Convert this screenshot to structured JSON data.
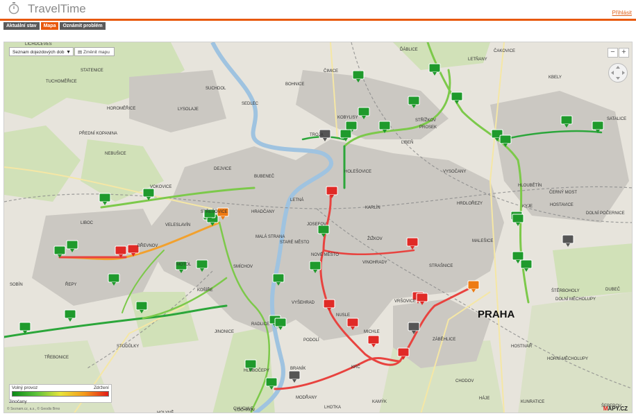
{
  "header": {
    "title": "TravelTime",
    "login": "Přihlásit"
  },
  "tabs": [
    {
      "label": "Aktuální stav"
    },
    {
      "label": "Mapa"
    },
    {
      "label": "Oznámit problém"
    }
  ],
  "map": {
    "selector_label": "Seznam dojezdových dob",
    "change_map_label": "Změnit mapu",
    "zoom_out": "−",
    "zoom_in": "+",
    "legend": {
      "free": "Volný provoz",
      "delay": "Zdržení"
    },
    "scale": "Jinočany",
    "copyright": "© Seznam.cz, a.s., © Geodis Brno",
    "city_label": "PRAHA",
    "brand": "MAPY.CZ",
    "districts": [
      "Ďáblice",
      "Čakovice",
      "Letňany",
      "Kbely",
      "Bohnice",
      "Čimice",
      "Suchdol",
      "Troja",
      "Kobylisy",
      "Střížkov",
      "Prosek",
      "Satalice",
      "Statenice",
      "Tuchoměřice",
      "Horoměřice",
      "Lysolaje",
      "Sedlec",
      "Přední Kopanina",
      "Nebušice",
      "Vokovice",
      "Dejvice",
      "Bubeneč",
      "Holešovice",
      "Libeň",
      "Vysočany",
      "Hloubětín",
      "Černý Most",
      "Liboc",
      "Střešovice",
      "Veleslavín",
      "Hradčany",
      "Letná",
      "Karlín",
      "Hrdlořezy",
      "Kyje",
      "Hostavice",
      "Dolní Počernice",
      "Břevnov",
      "Malá Strana",
      "Josefov",
      "Žižkov",
      "Malešice",
      "Řepy",
      "Motol",
      "Smíchov",
      "Staré Město",
      "Nové Město",
      "Vinohrady",
      "Strašnice",
      "Košíře",
      "Vyšehrad",
      "Vršovice",
      "Štěrboholy",
      "Dubeč",
      "Jinonice",
      "Radlice",
      "Nusle",
      "Michle",
      "Záběhlice",
      "Dolní Měcholupy",
      "Stodůlky",
      "Hlubočepy",
      "Podolí",
      "Krč",
      "Hostivař",
      "Horní Měcholupy",
      "Třebonice",
      "Braník",
      "Chodov",
      "Lhotka",
      "Háje",
      "Holyně",
      "Modřany",
      "Kunratice",
      "Lochkov",
      "Kamýk",
      "Šeberov",
      "Chuchle",
      "Sobín",
      "Lichoceves"
    ],
    "route_colors": {
      "free": "#1f9a2c",
      "light": "#7cc94a",
      "moderate": "#f2a12e",
      "heavy": "#e8433f",
      "unknown": "#666666"
    },
    "markers_summary": {
      "green": 36,
      "red": 10,
      "orange": 2,
      "gray": 4
    }
  }
}
